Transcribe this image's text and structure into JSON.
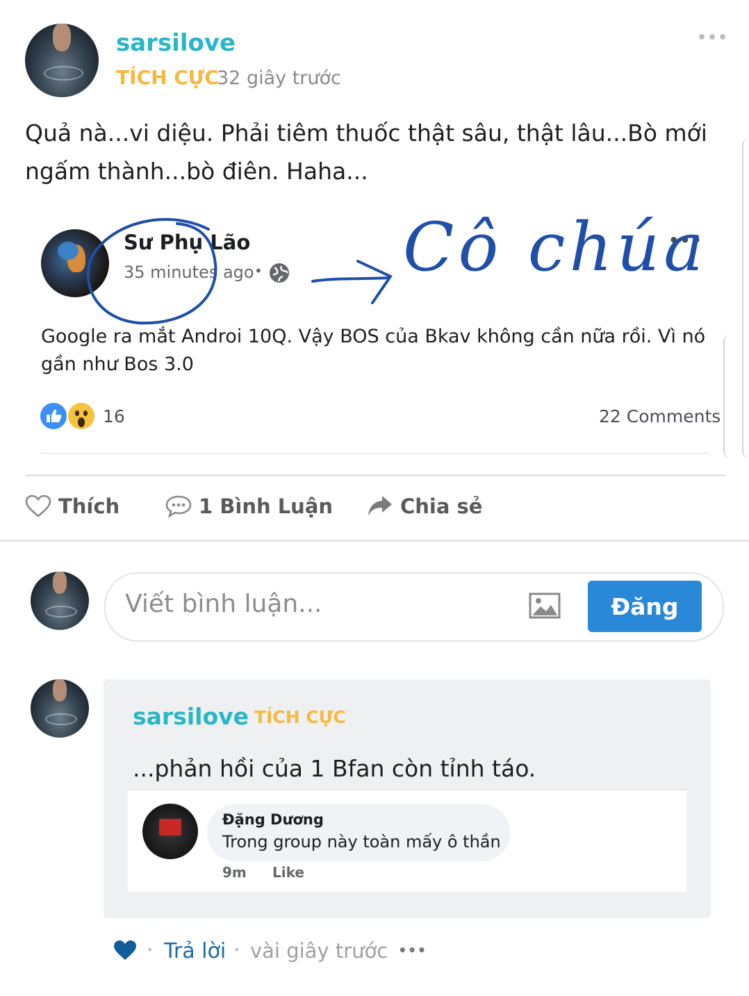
{
  "post": {
    "author": "sarsilove",
    "badge": "TÍCH CỰC",
    "time": "32 giây trước",
    "text": "Quả nà...vi diệu. Phải tiêm thuốc thật sâu, thật lâu...Bò mới ngấm thành...bò điên. Haha...",
    "more_icon": "more-dots-icon"
  },
  "embedded_fb_post": {
    "author": "Sư Phụ Lão",
    "time": "35 minutes ago",
    "separator": "•",
    "privacy_icon": "globe-icon",
    "text": "Google ra mắt Androi 10Q. Vậy BOS của Bkav không cần nữa rồi. Vì nó gần như Bos 3.0",
    "reaction_count": "16",
    "comments": "22 Comments",
    "annotation_text": "Cô chúa"
  },
  "actions": {
    "like": "Thích",
    "comment": "1 Bình Luận",
    "share": "Chia sẻ"
  },
  "composer": {
    "placeholder": "Viết bình luận...",
    "submit": "Đăng",
    "image_icon": "image-icon"
  },
  "comment": {
    "author": "sarsilove",
    "badge": "TÍCH CỰC",
    "text": "...phản hồi của 1 Bfan còn tỉnh táo.",
    "embedded_reply": {
      "author": "Đặng Dương",
      "text": "Trong group này toàn mấy ô thần",
      "time": "9m",
      "like": "Like"
    },
    "footer": {
      "reply": "Trả lời",
      "time": "vài giây trước"
    }
  },
  "colors": {
    "accent_teal": "#29b6c9",
    "badge_gold": "#f5b942",
    "button_blue": "#2a88d8",
    "ink_blue": "#1f4fa8",
    "heart_blue": "#125d9b"
  }
}
